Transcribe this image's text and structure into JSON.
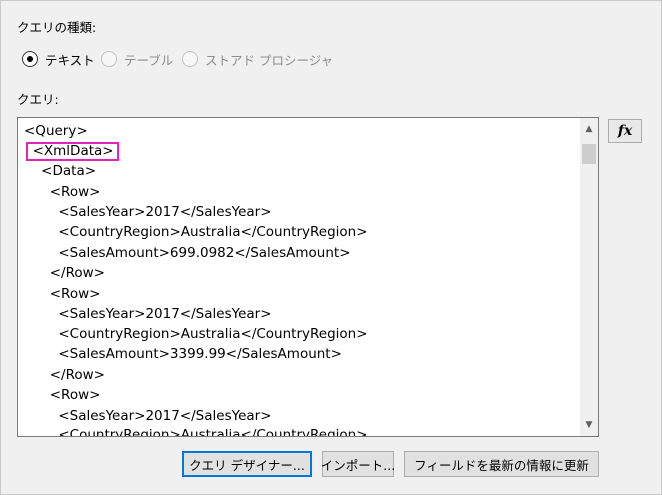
{
  "query_type": {
    "label": "クエリの種類:",
    "options": [
      {
        "label": "テキスト",
        "selected": true,
        "enabled": true
      },
      {
        "label": "テーブル",
        "selected": false,
        "enabled": false
      },
      {
        "label": "ストアド プロシージャ",
        "selected": false,
        "enabled": false
      }
    ]
  },
  "query": {
    "label": "クエリ:",
    "lines": [
      "<Query>",
      "  <XmlData>",
      "    <Data>",
      "      <Row>",
      "        <SalesYear>2017</SalesYear>",
      "        <CountryRegion>Australia</CountryRegion>",
      "        <SalesAmount>699.0982</SalesAmount>",
      "      </Row>",
      "      <Row>",
      "        <SalesYear>2017</SalesYear>",
      "        <CountryRegion>Australia</CountryRegion>",
      "        <SalesAmount>3399.99</SalesAmount>",
      "      </Row>",
      "      <Row>",
      "        <SalesYear>2017</SalesYear>",
      "        <CountryRegion>Australia</CountryRegion>"
    ],
    "highlight_color": "#e026b8"
  },
  "expression_button": {
    "label": "fx"
  },
  "buttons": {
    "query_designer": "クエリ デザイナー...",
    "import": "インポート...",
    "refresh_fields": "フィールドを最新の情報に更新"
  },
  "colors": {
    "default_button_border": "#0078d7",
    "background": "#f0f0f0"
  }
}
